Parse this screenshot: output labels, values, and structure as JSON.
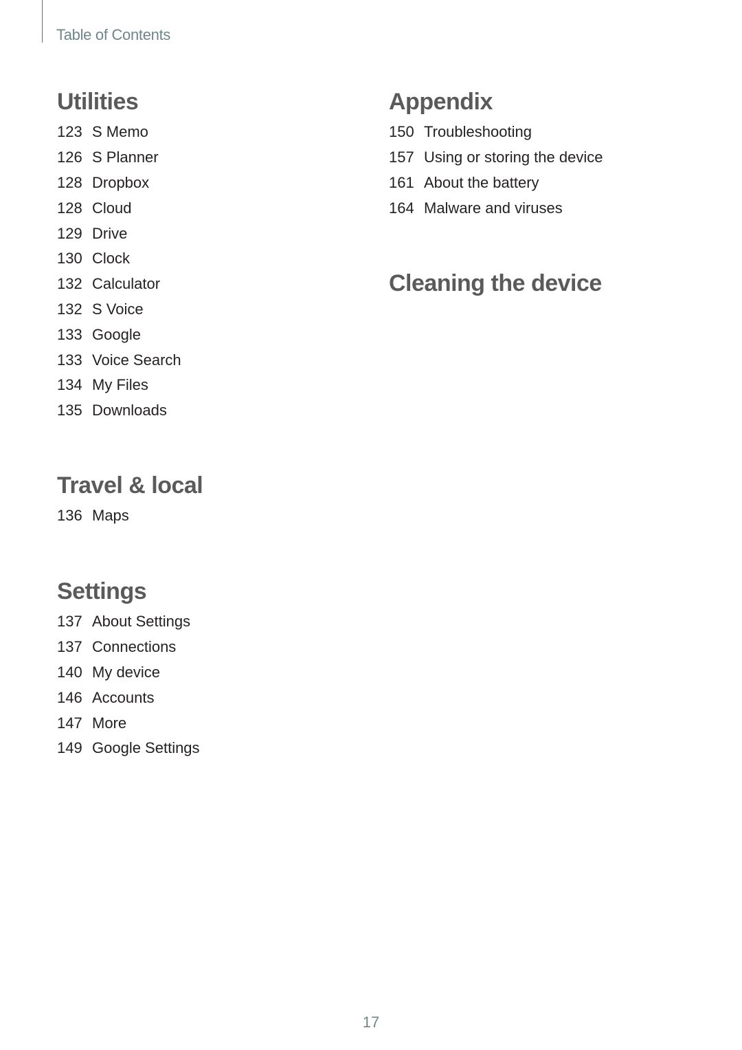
{
  "header": {
    "title": "Table of Contents"
  },
  "left_column": [
    {
      "title": "Utilities",
      "entries": [
        {
          "page": "123",
          "label": "S Memo"
        },
        {
          "page": "126",
          "label": "S Planner"
        },
        {
          "page": "128",
          "label": "Dropbox"
        },
        {
          "page": "128",
          "label": "Cloud"
        },
        {
          "page": "129",
          "label": "Drive"
        },
        {
          "page": "130",
          "label": "Clock"
        },
        {
          "page": "132",
          "label": "Calculator"
        },
        {
          "page": "132",
          "label": "S Voice"
        },
        {
          "page": "133",
          "label": "Google"
        },
        {
          "page": "133",
          "label": "Voice Search"
        },
        {
          "page": "134",
          "label": "My Files"
        },
        {
          "page": "135",
          "label": "Downloads"
        }
      ]
    },
    {
      "title": "Travel & local",
      "entries": [
        {
          "page": "136",
          "label": "Maps"
        }
      ]
    },
    {
      "title": "Settings",
      "entries": [
        {
          "page": "137",
          "label": "About Settings"
        },
        {
          "page": "137",
          "label": "Connections"
        },
        {
          "page": "140",
          "label": "My device"
        },
        {
          "page": "146",
          "label": "Accounts"
        },
        {
          "page": "147",
          "label": "More"
        },
        {
          "page": "149",
          "label": "Google Settings"
        }
      ]
    }
  ],
  "right_column": [
    {
      "title": "Appendix",
      "entries": [
        {
          "page": "150",
          "label": "Troubleshooting"
        },
        {
          "page": "157",
          "label": "Using or storing the device"
        },
        {
          "page": "161",
          "label": "About the battery"
        },
        {
          "page": "164",
          "label": "Malware and viruses"
        }
      ]
    },
    {
      "title": "Cleaning the device",
      "entries": []
    }
  ],
  "footer": {
    "page_number": "17"
  }
}
